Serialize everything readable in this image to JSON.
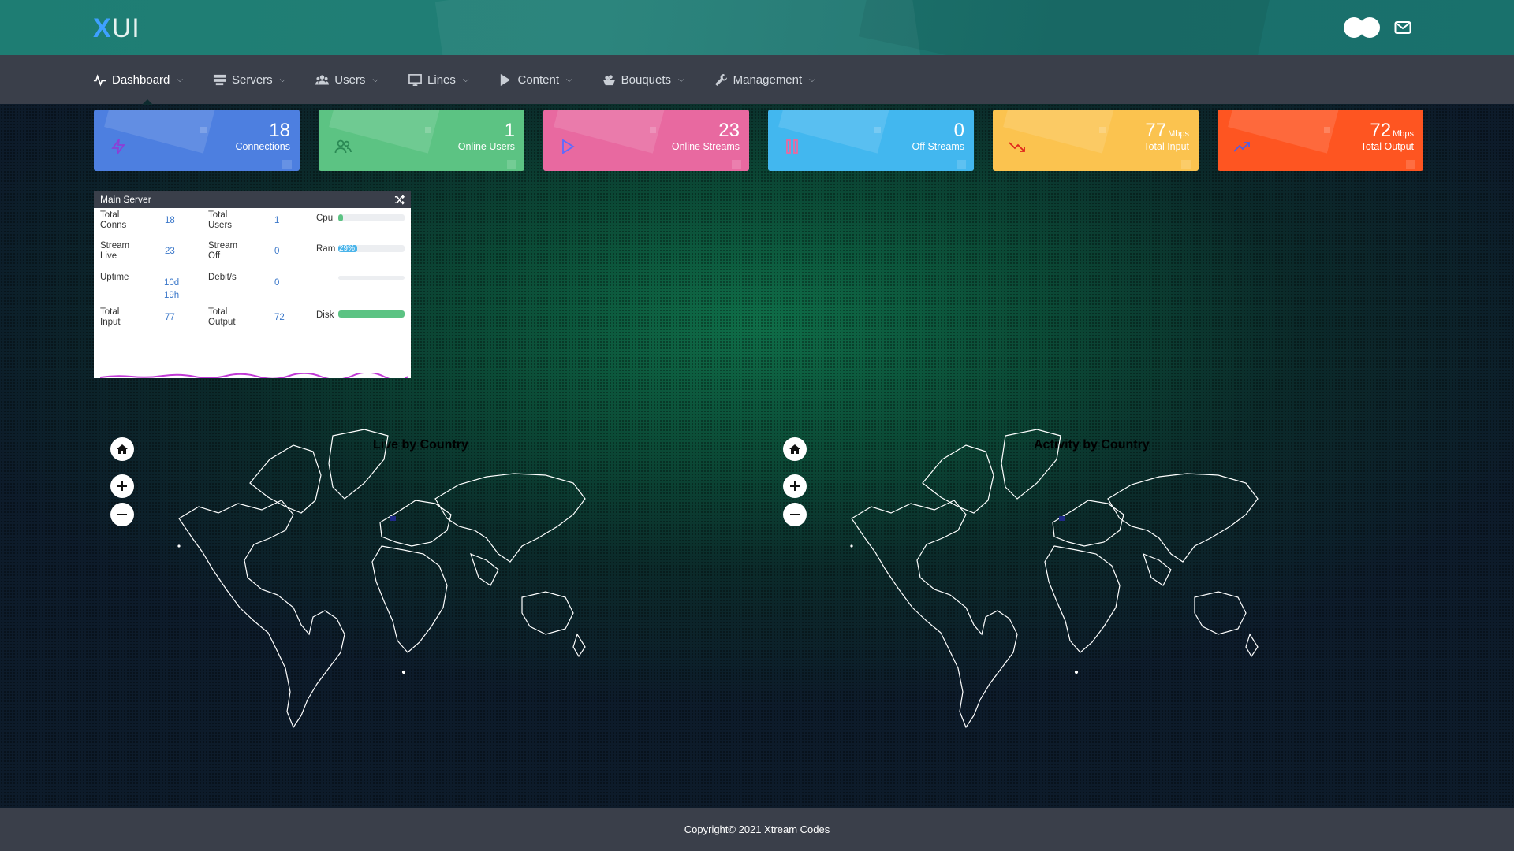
{
  "app": {
    "logo_x": "X",
    "logo_ui": "UI"
  },
  "header": {
    "icons": [
      "toggle-icon",
      "mail-icon"
    ]
  },
  "nav": [
    {
      "label": "Dashboard",
      "icon": "activity-icon",
      "active": true
    },
    {
      "label": "Servers",
      "icon": "server-icon",
      "active": false
    },
    {
      "label": "Users",
      "icon": "users-icon",
      "active": false
    },
    {
      "label": "Lines",
      "icon": "monitor-icon",
      "active": false
    },
    {
      "label": "Content",
      "icon": "play-icon",
      "active": false
    },
    {
      "label": "Bouquets",
      "icon": "bouquet-icon",
      "active": false
    },
    {
      "label": "Management",
      "icon": "wrench-icon",
      "active": false
    }
  ],
  "cards": [
    {
      "value": "18",
      "unit": "",
      "label": "Connections",
      "icon": "bolt-icon",
      "color": "#4d7fe0"
    },
    {
      "value": "1",
      "unit": "",
      "label": "Online Users",
      "icon": "users-icon",
      "color": "#5cc383"
    },
    {
      "value": "23",
      "unit": "",
      "label": "Online Streams",
      "icon": "play-icon",
      "color": "#e869a0"
    },
    {
      "value": "0",
      "unit": "",
      "label": "Off Streams",
      "icon": "pause-icon",
      "color": "#42b7ef"
    },
    {
      "value": "77",
      "unit": "Mbps",
      "label": "Total Input",
      "icon": "trend-down-icon",
      "color": "#fbc34f"
    },
    {
      "value": "72",
      "unit": "Mbps",
      "label": "Total Output",
      "icon": "trend-up-icon",
      "color": "#fe5521"
    }
  ],
  "server": {
    "title": "Main Server",
    "total_conns_label": "Total\nConns",
    "total_conns": "18",
    "total_users_label": "Total\nUsers",
    "total_users": "1",
    "stream_live_label": "Stream\nLive",
    "stream_live": "23",
    "stream_off_label": "Stream\nOff",
    "stream_off": "0",
    "uptime_label": "Uptime",
    "uptime_d": "10d",
    "uptime_h": "19h",
    "debit_label": "Debit/s",
    "debit": "0",
    "total_input_label": "Total\nInput",
    "total_input": "77",
    "total_output_label": "Total\nOutput",
    "total_output": "72",
    "cpu_label": "Cpu",
    "cpu_pct": 0.07,
    "ram_label": "Ram",
    "ram_pct": 0.29,
    "ram_text": "29%",
    "disk_label": "Disk",
    "disk_pct": 1.0
  },
  "maps": [
    {
      "title": "Live by Country"
    },
    {
      "title": "Activity by Country"
    }
  ],
  "footer": {
    "text": "Copyright© 2021 Xtream Codes"
  }
}
